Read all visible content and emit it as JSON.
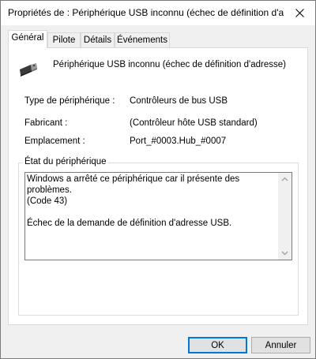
{
  "window": {
    "title": "Propriétés de : Périphérique USB inconnu (échec de définition d'a..."
  },
  "tabs": [
    {
      "label": "Général",
      "active": true
    },
    {
      "label": "Pilote",
      "active": false
    },
    {
      "label": "Détails",
      "active": false
    },
    {
      "label": "Événements",
      "active": false
    }
  ],
  "device": {
    "name": "Périphérique USB inconnu (échec de définition d'adresse)",
    "icon": "usb-plug-icon"
  },
  "properties": [
    {
      "label": "Type de périphérique :",
      "value": "Contrôleurs de bus USB"
    },
    {
      "label": "Fabricant :",
      "value": "(Contrôleur hôte USB standard)"
    },
    {
      "label": "Emplacement :",
      "value": "Port_#0003.Hub_#0007"
    }
  ],
  "status": {
    "legend": "État du périphérique",
    "text": "Windows a arrêté ce périphérique car il présente des problèmes.\n(Code 43)\n\nÉchec de la demande de définition d'adresse USB."
  },
  "buttons": {
    "ok": "OK",
    "cancel": "Annuler"
  },
  "colors": {
    "accent": "#0078d7",
    "window_bg": "#f0f0f0"
  }
}
